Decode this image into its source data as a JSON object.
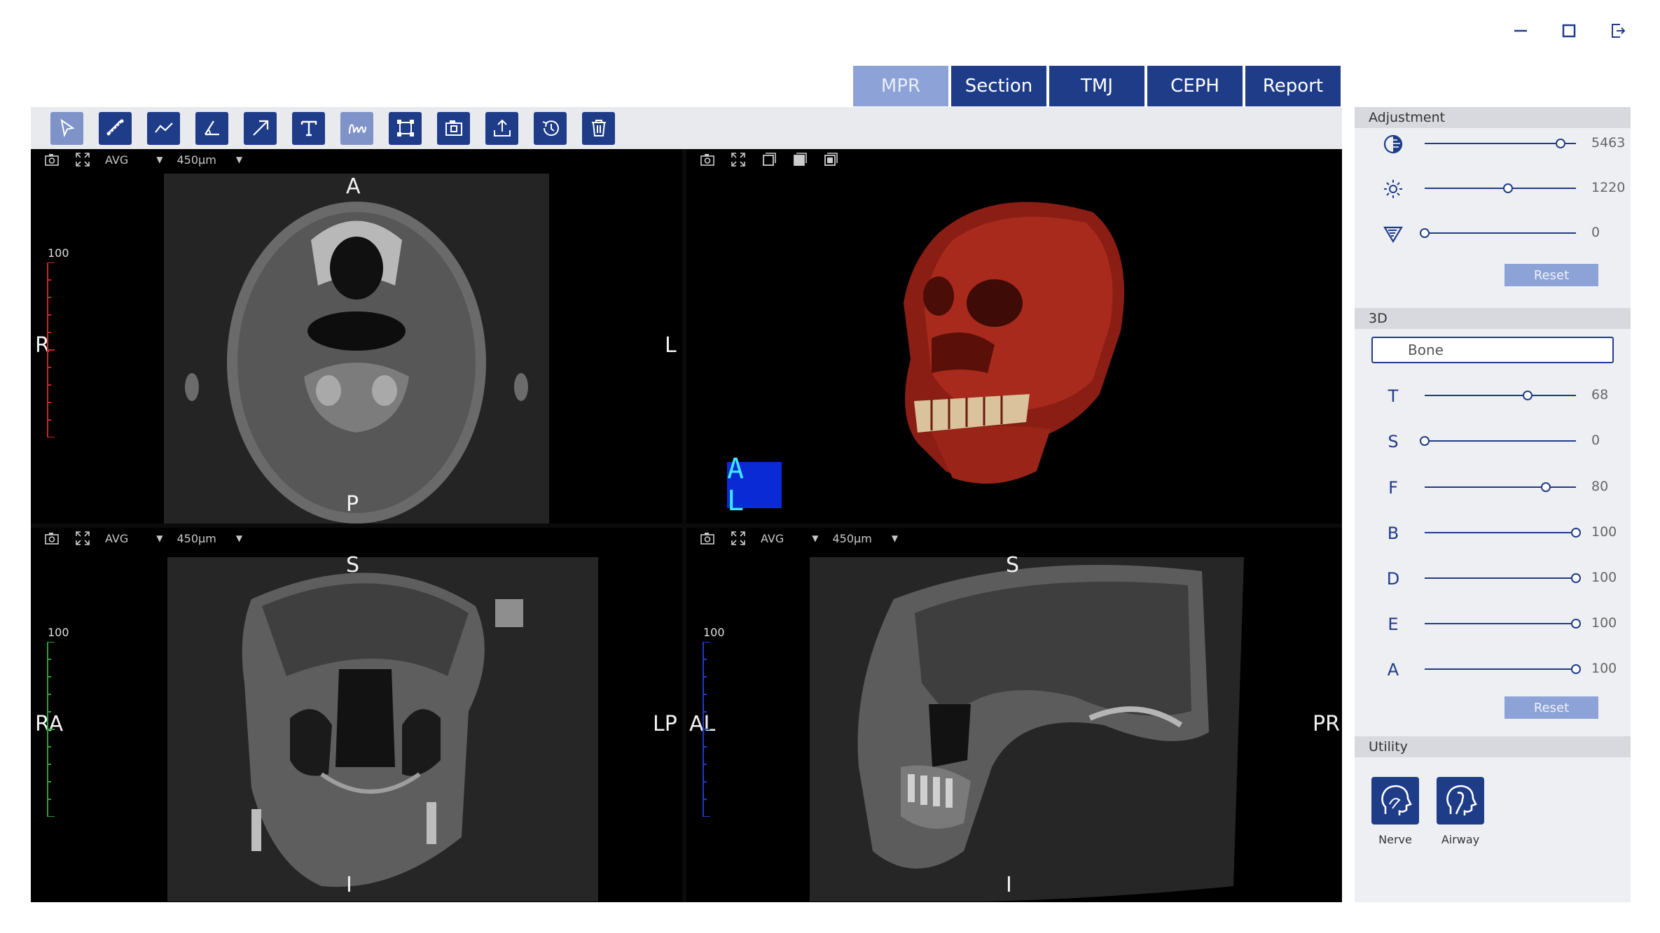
{
  "window_controls": {
    "minimize_icon": "minimize-icon",
    "maximize_icon": "maximize-icon",
    "exit_icon": "exit-icon"
  },
  "tabs": [
    {
      "label": "MPR",
      "active": true
    },
    {
      "label": "Section",
      "active": false
    },
    {
      "label": "TMJ",
      "active": false
    },
    {
      "label": "CEPH",
      "active": false
    },
    {
      "label": "Report",
      "active": false
    }
  ],
  "toolbar": {
    "tools": [
      "select-icon",
      "ruler-icon",
      "polyline-icon",
      "angle-icon",
      "arrow-icon",
      "text-icon",
      "curve-icon",
      "roi-icon",
      "screenshot-icon",
      "export-icon",
      "history-icon",
      "trash-icon"
    ]
  },
  "panes": {
    "axial": {
      "mode": "AVG",
      "thickness": "450µm",
      "scale": "100",
      "orient": {
        "top": "A",
        "bottom": "P",
        "left": "R",
        "right": "L"
      }
    },
    "volume3d": {
      "cube_label": "A L"
    },
    "coronal": {
      "mode": "AVG",
      "thickness": "450µm",
      "scale": "100",
      "orient": {
        "top": "S",
        "bottom": "I",
        "left": "RA",
        "right": "LP"
      }
    },
    "sagittal": {
      "mode": "AVG",
      "thickness": "450µm",
      "scale": "100",
      "orient": {
        "top": "S",
        "bottom": "I",
        "left": "AL",
        "right": "PR"
      }
    }
  },
  "adjustment": {
    "title": "Adjustment",
    "sliders": [
      {
        "icon": "contrast-icon",
        "value": "5463",
        "level": 0.9
      },
      {
        "icon": "brightness-icon",
        "value": "1220",
        "level": 0.55
      },
      {
        "icon": "filter-icon",
        "value": "0",
        "level": 0.0
      }
    ],
    "reset_label": "Reset"
  },
  "three_d": {
    "title": "3D",
    "preset": "Bone",
    "sliders": [
      {
        "label": "T",
        "value": "68",
        "level": 0.68
      },
      {
        "label": "S",
        "value": "0",
        "level": 0.0
      },
      {
        "label": "F",
        "value": "80",
        "level": 0.8
      },
      {
        "label": "B",
        "value": "100",
        "level": 1.0
      },
      {
        "label": "D",
        "value": "100",
        "level": 1.0
      },
      {
        "label": "E",
        "value": "100",
        "level": 1.0
      },
      {
        "label": "A",
        "value": "100",
        "level": 1.0
      }
    ],
    "reset_label": "Reset"
  },
  "utility": {
    "title": "Utility",
    "items": [
      {
        "label": "Nerve",
        "icon": "head-nerve-icon"
      },
      {
        "label": "Airway",
        "icon": "head-airway-icon"
      }
    ]
  },
  "colors": {
    "accent": "#1f3c88",
    "accent_light": "#8da2d6",
    "scale_axial": "#c62828",
    "scale_coronal": "#2e9e3b",
    "scale_sagittal": "#1f3cc8"
  }
}
